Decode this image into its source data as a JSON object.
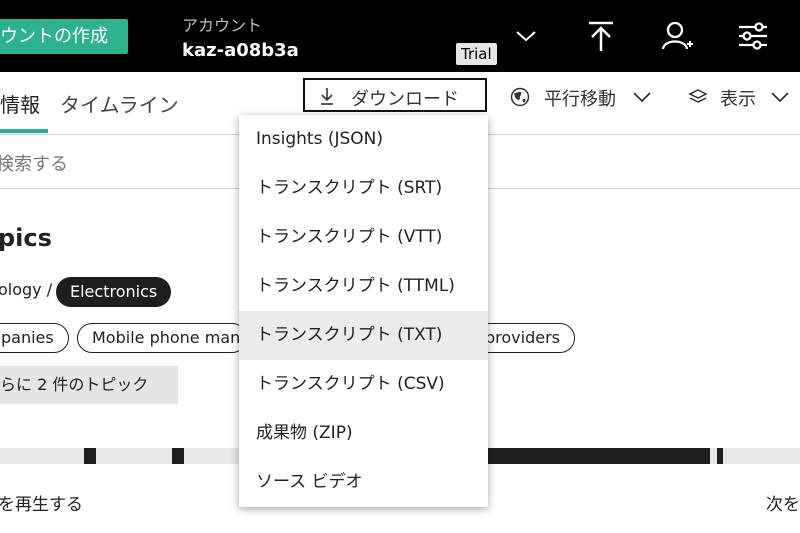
{
  "header": {
    "create_label": "ウントの作成",
    "account_label": "アカウント",
    "account_name": "kaz-a08b3a",
    "trial_badge": "Trial"
  },
  "tabs": [
    {
      "label": "情報"
    },
    {
      "label": "タイムライン"
    }
  ],
  "toolbar": {
    "download_label": "ダウンロード",
    "translate_label": "平行移動",
    "view_label": "表示"
  },
  "search": {
    "placeholder": "検索する"
  },
  "topics": {
    "title": "pics",
    "breadcrumb": "ology /",
    "selected_chip": "Electronics",
    "chips": [
      "panies",
      "Mobile phone man",
      "providers"
    ],
    "more_label": "らに 2 件のトピック"
  },
  "player": {
    "play_label": "を再生する",
    "next_label": "次を"
  },
  "download_menu": {
    "items": [
      "Insights (JSON)",
      "トランスクリプト (SRT)",
      "トランスクリプト (VTT)",
      "トランスクリプト (TTML)",
      "トランスクリプト (TXT)",
      "トランスクリプト (CSV)",
      "成果物 (ZIP)",
      "ソース ビデオ"
    ],
    "highlighted_index": 4
  },
  "colors": {
    "accent": "#2db38c",
    "topbar": "#000000"
  }
}
